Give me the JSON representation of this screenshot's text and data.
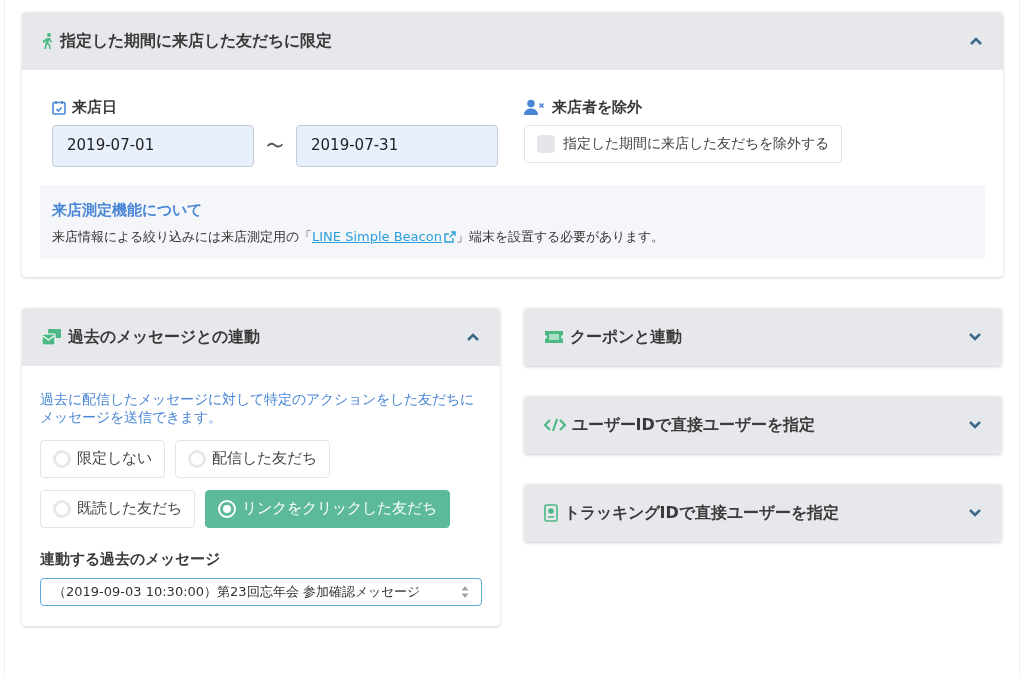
{
  "visit_section": {
    "title": "指定した期間に来店した友だちに限定",
    "expanded": true,
    "date_label": "来店日",
    "date_from": "2019-07-01",
    "separator": "〜",
    "date_to": "2019-07-31",
    "exclude_label": "来店者を除外",
    "exclude_checkbox": {
      "label": "指定した期間に来店した友だちを除外する",
      "checked": false
    },
    "info": {
      "title": "来店測定機能について",
      "text_before": "来店情報による絞り込みには来店測定用の「",
      "link": "LINE Simple Beacon",
      "text_after": "」端末を設置する必要があります。"
    }
  },
  "message_section": {
    "title": "過去のメッセージとの連動",
    "expanded": true,
    "description": "過去に配信したメッセージに対して特定のアクションをした友だちにメッセージを送信できます。",
    "options": [
      {
        "label": "限定しない",
        "selected": false
      },
      {
        "label": "配信した友だち",
        "selected": false
      },
      {
        "label": "既読した友だち",
        "selected": false
      },
      {
        "label": "リンクをクリックした友だち",
        "selected": true
      }
    ],
    "select_label": "連動する過去のメッセージ",
    "select_value": "（2019-09-03 10:30:00）第23回忘年会 参加確認メッセージ"
  },
  "side_sections": [
    {
      "title": "クーポンと連動",
      "expanded": false
    },
    {
      "title": "ユーザーIDで直接ユーザーを指定",
      "expanded": false
    },
    {
      "title": "トラッキングIDで直接ユーザーを指定",
      "expanded": false
    }
  ]
}
